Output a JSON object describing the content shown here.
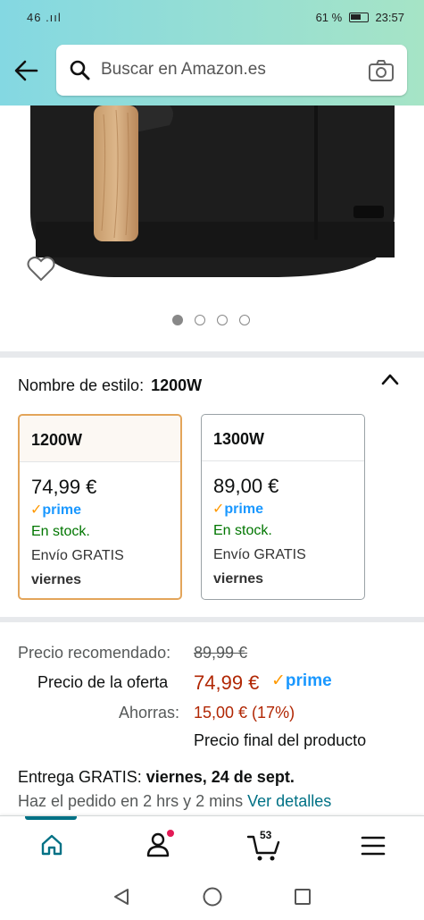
{
  "status_bar": {
    "signal": "46 .ııl",
    "battery": "61 %",
    "time": "23:57"
  },
  "header": {
    "back_icon": "arrow-left-icon",
    "search_placeholder": "Buscar en Amazon.es",
    "search_icon": "search-icon",
    "camera_icon": "camera-icon"
  },
  "gallery": {
    "favorite_icon": "heart-icon",
    "image_count": 4,
    "active_index": 0
  },
  "style": {
    "label": "Nombre de estilo:",
    "selected": "1200W",
    "options": [
      {
        "name": "1200W",
        "price": "74,99 €",
        "prime": "prime",
        "stock": "En stock.",
        "shipping": "Envío GRATIS",
        "day": "viernes"
      },
      {
        "name": "1300W",
        "price": "89,00 €",
        "prime": "prime",
        "stock": "En stock.",
        "shipping": "Envío GRATIS",
        "day": "viernes"
      }
    ]
  },
  "pricing": {
    "recommended_label": "Precio recomendado:",
    "recommended_value": "89,99 €",
    "deal_label": "Precio de la oferta",
    "deal_value": "74,99 €",
    "deal_prime": "prime",
    "savings_label": "Ahorras:",
    "savings_value": "15,00 € (17%)",
    "final_note": "Precio final del producto"
  },
  "delivery": {
    "prefix": "Entrega GRATIS:",
    "date": "viernes, 24 de sept.",
    "order_within": "Haz el pedido en 2 hrs y 2 mins",
    "details_link": "Ver detalles"
  },
  "bottom_nav": {
    "cart_count": "53",
    "colors": {
      "accent": "#007185",
      "price": "#b12704",
      "prime": "#1a98ff",
      "stock": "#007600",
      "selected_border": "#e3a55a"
    }
  }
}
